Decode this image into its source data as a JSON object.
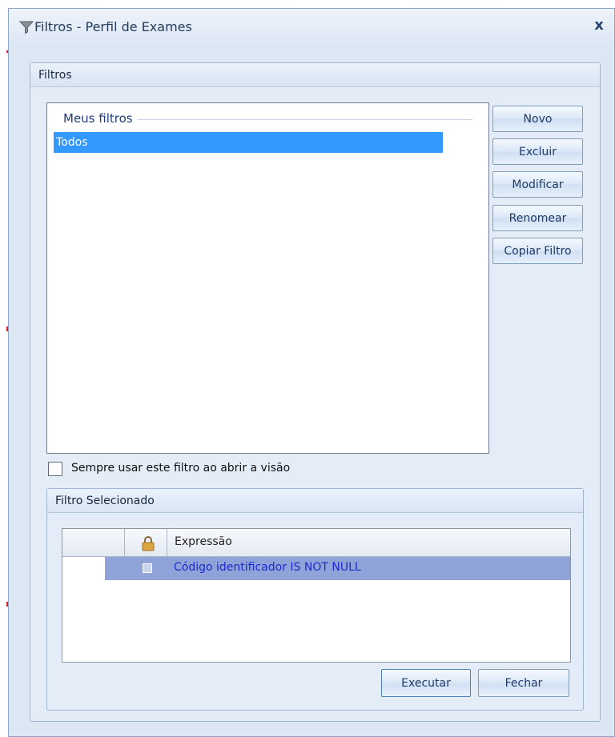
{
  "window": {
    "title": "Filtros - Perfil de Exames",
    "close_label": "x"
  },
  "filters_group": {
    "title": "Filtros",
    "list": {
      "group_title": "Meus filtros",
      "items": [
        "Todos"
      ]
    },
    "buttons": {
      "new": "Novo",
      "delete": "Excluir",
      "modify": "Modificar",
      "rename": "Renomear",
      "copy": "Copiar Filtro"
    },
    "checkbox": {
      "label": "Sempre usar este filtro ao abrir a visão",
      "checked": false
    }
  },
  "selected_filter": {
    "title": "Filtro Selecionado",
    "grid": {
      "header_expression": "Expressão",
      "rows": [
        {
          "locked": false,
          "expression": "Código identificador IS NOT NULL"
        }
      ]
    }
  },
  "footer": {
    "execute_label": "Executar",
    "close_label": "Fechar"
  },
  "icons": {
    "title": "filter-icon",
    "lock": "lock-icon"
  },
  "colors": {
    "selection": "#3399ff",
    "grid_row": "#8fa3d8",
    "grid_row_text": "#1a2bc8"
  }
}
